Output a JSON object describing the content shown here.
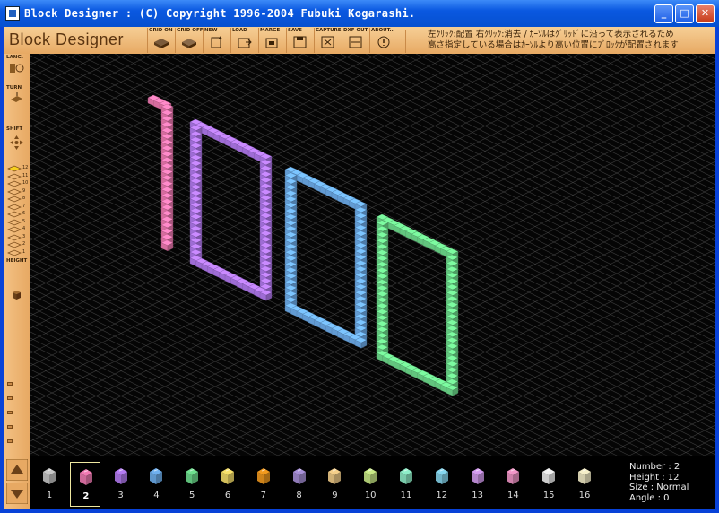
{
  "window": {
    "title": "Block Designer : (C) Copyright 1996-2004 Fubuki Kogarashi.",
    "controls": {
      "minimize": "_",
      "maximize": "□",
      "close": "✕"
    }
  },
  "toolbar": {
    "brand": "Block Designer",
    "tools": [
      {
        "label": "GRID ON",
        "icon": "grid-on-icon"
      },
      {
        "label": "GRID OFF",
        "icon": "grid-off-icon"
      },
      {
        "label": "NEW",
        "icon": "new-icon"
      },
      {
        "label": "LOAD",
        "icon": "load-icon"
      },
      {
        "label": "MARGE",
        "icon": "merge-icon"
      },
      {
        "label": "SAVE",
        "icon": "save-icon"
      },
      {
        "label": "CAPTURE",
        "icon": "capture-icon"
      },
      {
        "label": "DXF OUT",
        "icon": "dxf-out-icon"
      },
      {
        "label": "ABOUT..",
        "icon": "about-icon"
      }
    ],
    "hint_line1": "左ｸﾘｯｸ:配置 右ｸﾘｯｸ:消去 / ｶｰｿﾙはｸﾞﾘｯﾄﾞに沿って表示されるため",
    "hint_line2": "高さ指定している場合はｶｰｿﾙより高い位置にﾌﾞﾛｯｸが配置されます"
  },
  "left_panel": {
    "lang_label": "LANG.",
    "turn_label": "TURN",
    "shift_label": "SHIFT",
    "height_label": "HEIGHT",
    "height_levels": [
      "12",
      "11",
      "10",
      "9",
      "8",
      "7",
      "6",
      "5",
      "4",
      "3",
      "2",
      "1"
    ],
    "current_height": 12
  },
  "palette": {
    "colors": [
      {
        "num": "1",
        "hex": "#c8c8c8"
      },
      {
        "num": "2",
        "hex": "#f27bb4"
      },
      {
        "num": "3",
        "hex": "#b47bf2"
      },
      {
        "num": "4",
        "hex": "#6fb0f0"
      },
      {
        "num": "5",
        "hex": "#6fe08f"
      },
      {
        "num": "6",
        "hex": "#f7e06a"
      },
      {
        "num": "7",
        "hex": "#f29a1e"
      },
      {
        "num": "8",
        "hex": "#a890d8"
      },
      {
        "num": "9",
        "hex": "#f5cf8a"
      },
      {
        "num": "10",
        "hex": "#c9ea86"
      },
      {
        "num": "11",
        "hex": "#8eeec8"
      },
      {
        "num": "12",
        "hex": "#86d6ee"
      },
      {
        "num": "13",
        "hex": "#d49cf0"
      },
      {
        "num": "14",
        "hex": "#f296c8"
      },
      {
        "num": "15",
        "hex": "#f0f0f0"
      },
      {
        "num": "16",
        "hex": "#f5eec8"
      }
    ],
    "selected": 2
  },
  "info": {
    "number": "Number :  2",
    "height": "Height :  12",
    "size": "Size : Normal",
    "angle": "Angle : 0"
  },
  "model": {
    "description_colors": {
      "one": "#f27bb4",
      "zero1": "#b47bf2",
      "zero2": "#6fb0f0",
      "zero3": "#6fe08f"
    }
  }
}
